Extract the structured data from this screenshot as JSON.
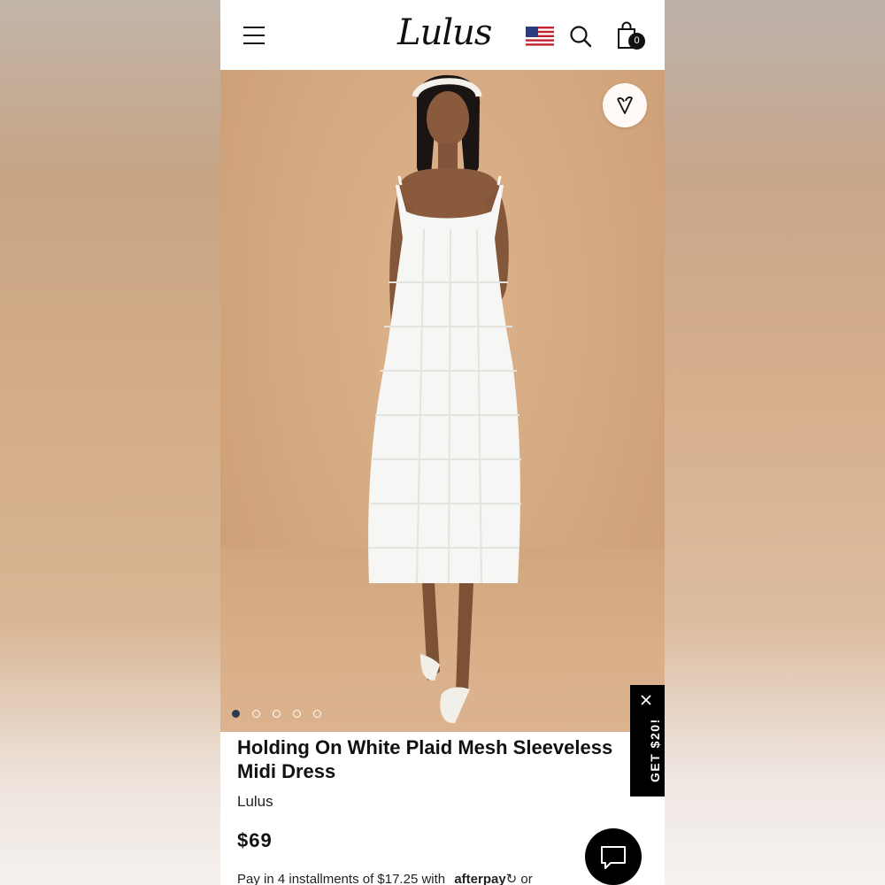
{
  "header": {
    "logo_text": "Lulus",
    "cart_count": "0",
    "icons": [
      "menu-icon",
      "us-flag-icon",
      "search-icon",
      "shopping-bag-icon"
    ]
  },
  "gallery": {
    "image_count": 5,
    "active_index": 0,
    "favorite_icon": "heart-icon"
  },
  "promo": {
    "label": "GET $20!",
    "close_icon": "close-icon"
  },
  "product": {
    "title": "Holding On White Plaid Mesh Sleeveless Midi Dress",
    "brand": "Lulus",
    "price": "$69",
    "installment_text": "Pay in 4 installments of $17.25 with",
    "installment_provider": "afterpay",
    "installment_suffix": "or"
  },
  "chat": {
    "icon": "chat-icon"
  },
  "colors": {
    "accent_dark": "#000000",
    "active_dot": "#2d3b4d",
    "hero_background": "#d6ab83"
  }
}
